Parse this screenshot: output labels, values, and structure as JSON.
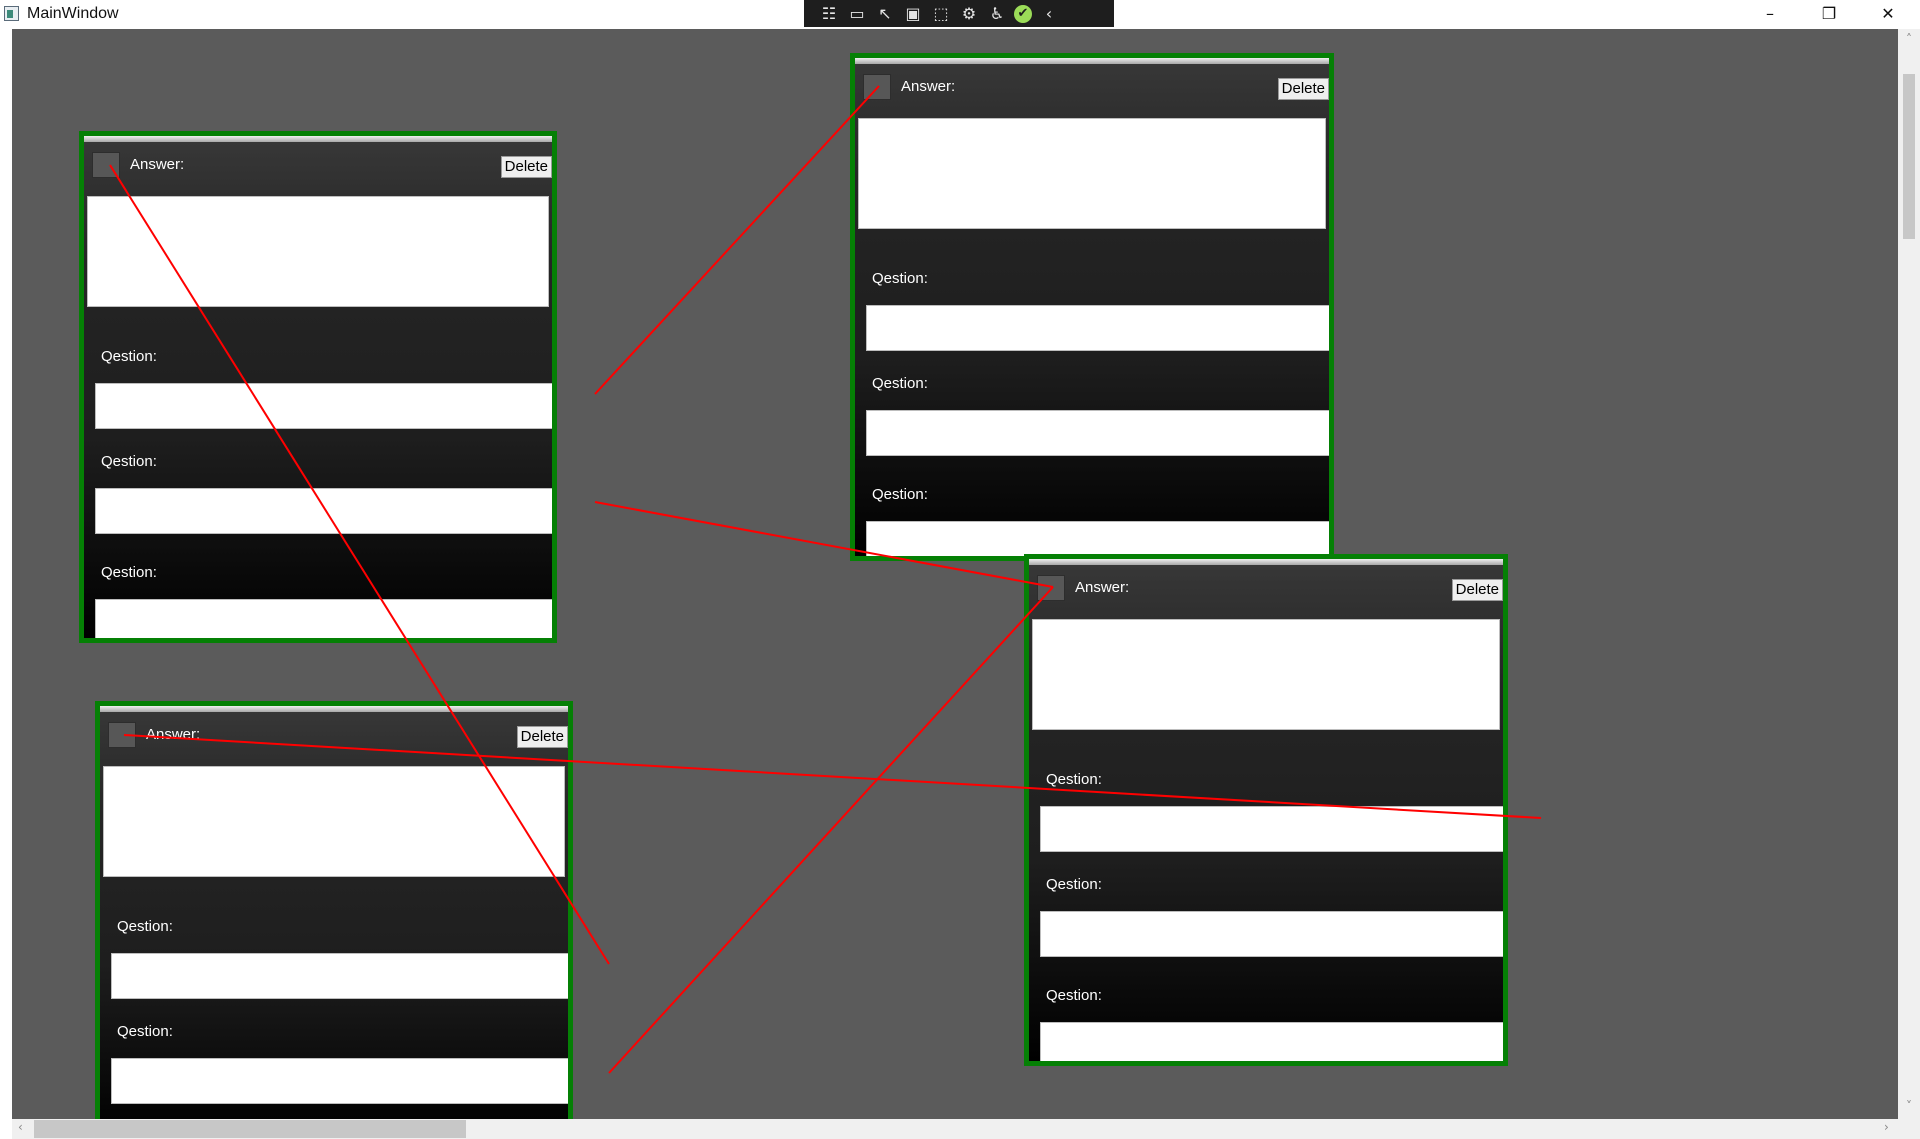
{
  "window": {
    "title": "MainWindow"
  },
  "devtools": {
    "icons": [
      "select-element-icon",
      "live-visual-tree-icon",
      "inspect-icon",
      "track-focus-icon",
      "display-layout-icon",
      "binding-failures-icon",
      "accessibility-icon",
      "checkmark-icon",
      "collapse-icon"
    ]
  },
  "cards": [
    {
      "answer_label": "Answer:",
      "delete_label": "Delete",
      "questions": [
        {
          "label": "Qestion:"
        },
        {
          "label": "Qestion:"
        },
        {
          "label": "Qestion:"
        }
      ]
    },
    {
      "answer_label": "Answer:",
      "delete_label": "Delete",
      "questions": [
        {
          "label": "Qestion:"
        },
        {
          "label": "Qestion:"
        },
        {
          "label": "Qestion:"
        }
      ]
    },
    {
      "answer_label": "Answer:",
      "delete_label": "Delete",
      "questions": [
        {
          "label": "Qestion:"
        },
        {
          "label": "Qestion:"
        },
        {
          "label": "Qestion:"
        }
      ]
    },
    {
      "answer_label": "Answer:",
      "delete_label": "Delete",
      "questions": [
        {
          "label": "Qestion:"
        },
        {
          "label": "Qestion:"
        }
      ]
    }
  ],
  "colors": {
    "card_border": "#058005",
    "connector": "#ff0000",
    "canvas": "#5b5b5b"
  }
}
